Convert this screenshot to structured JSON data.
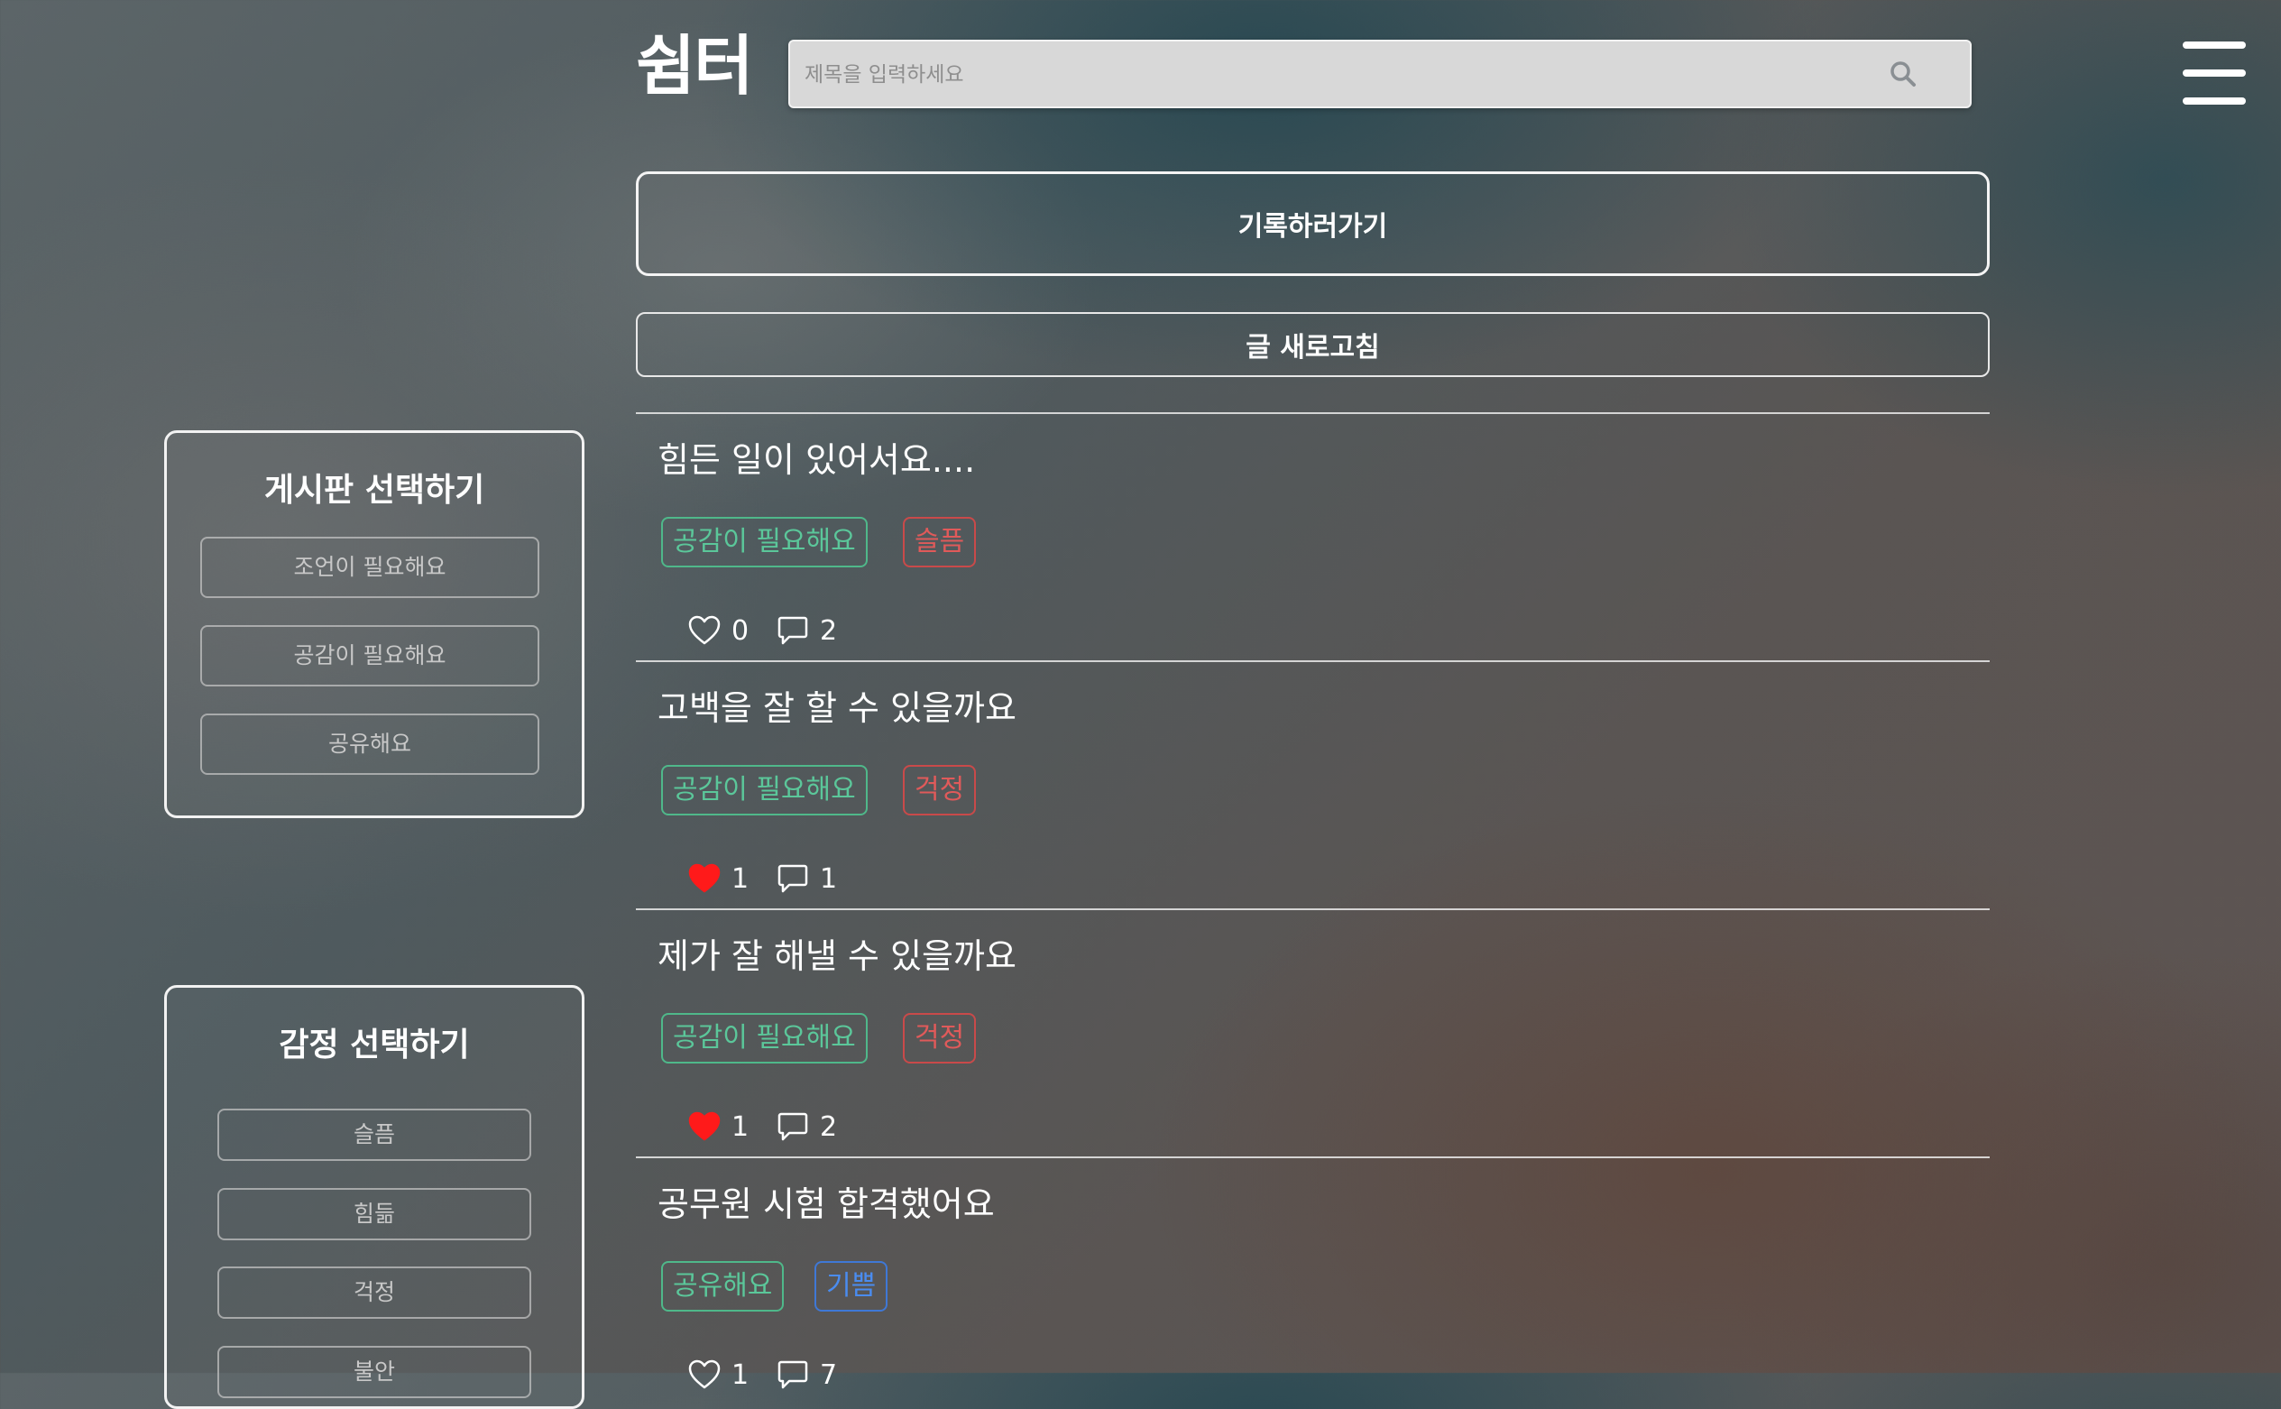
{
  "header": {
    "logo": "쉼터",
    "search_placeholder": "제목을 입력하세요",
    "search_value": ""
  },
  "actions": {
    "record_label": "기록하러가기",
    "refresh_label": "글 새로고침"
  },
  "board_panel": {
    "title": "게시판 선택하기",
    "options": [
      "조언이 필요해요",
      "공감이 필요해요",
      "공유해요"
    ]
  },
  "emotion_panel": {
    "title": "감정 선택하기",
    "options": [
      "슬픔",
      "힘듦",
      "걱정",
      "불안"
    ]
  },
  "posts": [
    {
      "title": "힘든 일이 있어서요....",
      "board_tag": "공감이 필요해요",
      "emotion_tag": "슬픔",
      "likes": "0",
      "liked": false,
      "comments": "2"
    },
    {
      "title": "고백을 잘 할 수 있을까요",
      "board_tag": "공감이 필요해요",
      "emotion_tag": "걱정",
      "likes": "1",
      "liked": true,
      "comments": "1"
    },
    {
      "title": "제가 잘 해낼 수 있을까요",
      "board_tag": "공감이 필요해요",
      "emotion_tag": "걱정",
      "likes": "1",
      "liked": true,
      "comments": "2"
    },
    {
      "title": "공무원 시험 합격했어요",
      "board_tag": "공유해요",
      "emotion_tag": "기쁨",
      "likes": "1",
      "liked": false,
      "comments": "7"
    }
  ],
  "colors": {
    "board_tag": "#5bc79a",
    "sad_worry_tag": "#e05a5a",
    "joy_tag": "#4a8cf0",
    "liked_heart": "#ff1a1a"
  },
  "icons": {
    "search": "search-icon",
    "menu": "hamburger-menu-icon",
    "like": "heart-icon",
    "comment": "comment-icon"
  }
}
